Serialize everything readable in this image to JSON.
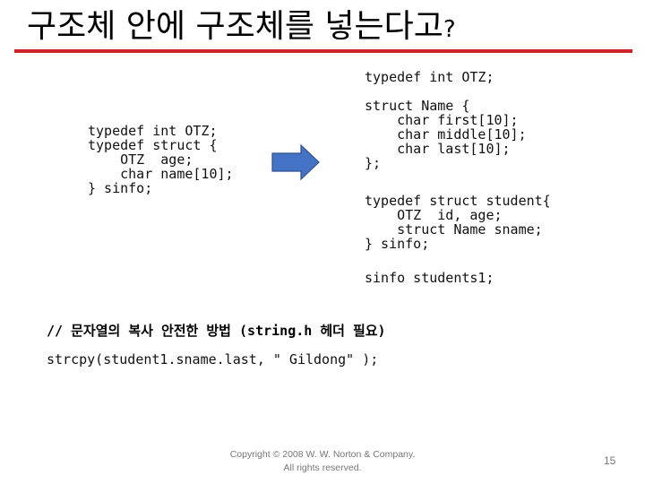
{
  "slide": {
    "title": "구조체 안에 구조체를 넣는다고",
    "title_suffix": "?",
    "accent_color": "#d0222a",
    "arrow_color": "#4472c4",
    "arrow_icon": "right-arrow-icon"
  },
  "left_code": {
    "lines": [
      "typedef int OTZ;",
      "typedef struct {",
      "    OTZ  age;",
      "    char name[10];",
      "} sinfo;"
    ]
  },
  "right_code": {
    "typedef_line": "typedef int OTZ;",
    "struct_name_lines": [
      "struct Name {",
      "    char first[10];",
      "    char middle[10];",
      "    char last[10];",
      "};"
    ],
    "typedef_student_lines": [
      "typedef struct student{",
      "    OTZ  id, age;",
      "    struct Name sname;",
      "} sinfo;"
    ],
    "declaration_line": "sinfo students1;"
  },
  "bottom_code": {
    "comment": "// 문자열의 복사 안전한 방법 (string.h 헤더 필요)",
    "statement": "strcpy(student1.sname.last, \" Gildong\" );"
  },
  "footer": {
    "copyright_line1": "Copyright © 2008 W. W. Norton & Company.",
    "copyright_line2": "All rights reserved.",
    "page_number": "15"
  }
}
